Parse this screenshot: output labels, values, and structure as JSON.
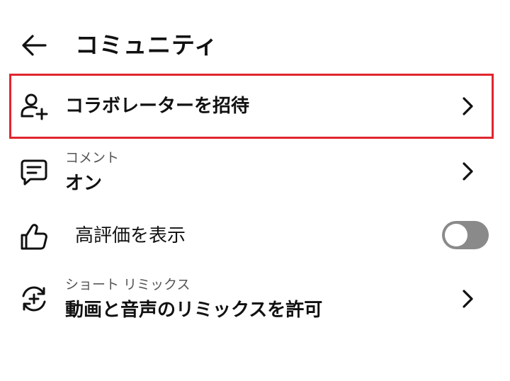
{
  "header": {
    "title": "コミュニティ",
    "back_icon": "arrow-left-icon"
  },
  "rows": {
    "invite": {
      "label": "コラボレーターを招待",
      "icon": "person-add-icon",
      "highlight_color": "#e0262f"
    },
    "comments": {
      "caption": "コメント",
      "value": "オン",
      "icon": "comment-icon"
    },
    "likes": {
      "label": "高評価を表示",
      "icon": "thumbs-up-icon",
      "toggle_on": false
    },
    "remix": {
      "caption": "ショート リミックス",
      "value": "動画と音声のリミックスを許可",
      "icon": "remix-icon"
    }
  }
}
